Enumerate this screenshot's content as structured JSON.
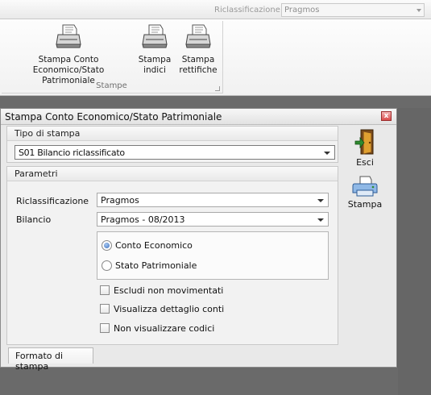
{
  "topbar": {
    "label": "Riclassificazione:",
    "value": "Pragmos"
  },
  "ribbon": {
    "group_title": "Stampe",
    "buttons": [
      {
        "label_line1": "Stampa Conto Economico/Stato",
        "label_line2": "Patrimoniale",
        "icon": "printer-icon"
      },
      {
        "label_line1": "Stampa",
        "label_line2": "indici",
        "icon": "printer-icon"
      },
      {
        "label_line1": "Stampa",
        "label_line2": "rettifiche",
        "icon": "printer-icon"
      }
    ]
  },
  "dialog": {
    "title": "Stampa Conto Economico/Stato Patrimoniale",
    "close_symbol": "x",
    "tipo_panel": {
      "title": "Tipo di stampa",
      "value": "S01 Bilancio riclassificato"
    },
    "parametri_panel": {
      "title": "Parametri",
      "riclassificazione_label": "Riclassificazione",
      "riclassificazione_value": "Pragmos",
      "bilancio_label": "Bilancio",
      "bilancio_value": "Pragmos - 08/2013",
      "radios": [
        {
          "label": "Conto Economico",
          "checked": true
        },
        {
          "label": "Stato Patrimoniale",
          "checked": false
        }
      ],
      "checkboxes": [
        {
          "label": "Escludi non movimentati",
          "checked": false
        },
        {
          "label": "Visualizza dettaglio conti",
          "checked": false
        },
        {
          "label": "Non visualizzare codici",
          "checked": false
        }
      ]
    },
    "tab_label": "Formato di stampa",
    "side_buttons": {
      "exit_label": "Esci",
      "print_label": "Stampa"
    }
  },
  "colors": {
    "accent_blue": "#3a6fbf",
    "close_red": "#d94a4a",
    "background_gray": "#5f5f5f"
  }
}
